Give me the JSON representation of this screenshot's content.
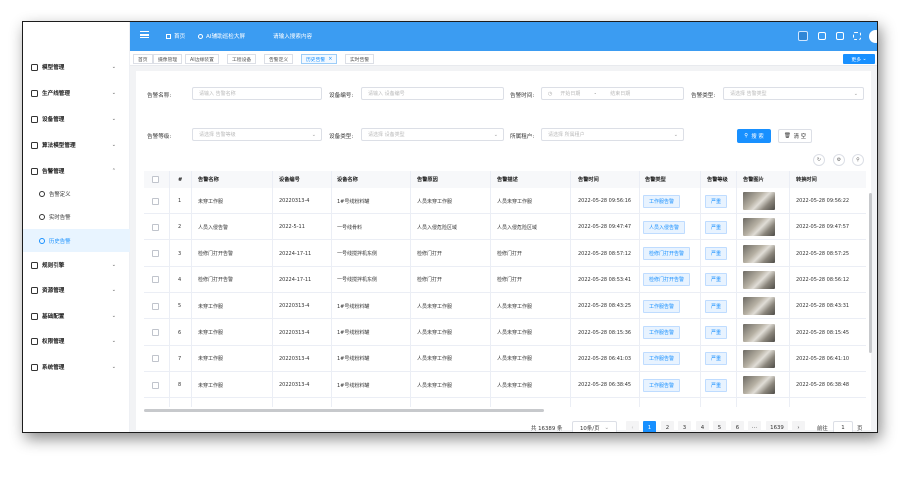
{
  "sidebar": {
    "items": [
      {
        "label": "模型管理",
        "icon": "grid-icon"
      },
      {
        "label": "生产线管理",
        "icon": "hierarchy-icon"
      },
      {
        "label": "设备管理",
        "icon": "device-icon"
      },
      {
        "label": "算法模型管理",
        "icon": "algorithm-icon"
      },
      {
        "label": "告警管理",
        "icon": "bell-icon",
        "expanded": true
      },
      {
        "label": "规则引擎",
        "icon": "rules-icon"
      },
      {
        "label": "资源管理",
        "icon": "resource-icon"
      },
      {
        "label": "基础配置",
        "icon": "cloud-icon"
      },
      {
        "label": "权限管理",
        "icon": "permission-icon"
      },
      {
        "label": "系统管理",
        "icon": "system-icon"
      }
    ],
    "sub_items": [
      {
        "label": "告警定义",
        "icon": "phone-icon"
      },
      {
        "label": "实时告警",
        "icon": "info-icon"
      },
      {
        "label": "历史告警",
        "icon": "bell-icon",
        "active": true
      }
    ]
  },
  "topbar": {
    "home": "首页",
    "screen": "AI辅助巡检大屏",
    "search_placeholder": "请输入搜索内容"
  },
  "tabs": [
    {
      "label": "首页"
    },
    {
      "label": "摄像管理"
    },
    {
      "label": "AI边缘装置"
    },
    {
      "label": "工程设备"
    },
    {
      "label": "告警定义"
    },
    {
      "label": "历史告警",
      "active": true
    },
    {
      "label": "实时告警"
    }
  ],
  "more_label": "更多",
  "filters": {
    "alarm_name_label": "告警名称:",
    "alarm_name_ph": "请输入 告警名称",
    "device_no_label": "设备编号:",
    "device_no_ph": "请输入 设备编号",
    "alarm_time_label": "告警时间:",
    "start_ph": "开始日期",
    "dash": "-",
    "end_ph": "结束日期",
    "alarm_type_label": "告警类型:",
    "alarm_type_ph": "请选择 告警类型",
    "alarm_level_label": "告警等级:",
    "alarm_level_ph": "请选择 告警等级",
    "device_type_label": "设备类型:",
    "device_type_ph": "请选择 设备类型",
    "tenant_label": "所属租户:",
    "tenant_ph": "请选择 所属租户",
    "search_btn": "搜 索",
    "reset_btn": "清 空"
  },
  "table": {
    "headers": [
      "#",
      "告警名称",
      "设备编号",
      "设备名称",
      "告警原因",
      "告警描述",
      "告警时间",
      "告警类型",
      "告警等级",
      "告警图片",
      "转换时间"
    ],
    "rows": [
      {
        "n": "1",
        "name": "未穿工作服",
        "dev_no": "20220313-4",
        "dev_name": "1#号线粉料罐",
        "reason": "人员未穿工作服",
        "desc": "人员未穿工作服",
        "time": "2022-05-28 09:56:16",
        "type": "工作服告警",
        "level": "严重",
        "conv": "2022-05-28 09:56:22"
      },
      {
        "n": "2",
        "name": "人员入侵告警",
        "dev_no": "2022-5-11",
        "dev_name": "一号线骨料",
        "reason": "人员入侵危险区域",
        "desc": "人员入侵危险区域",
        "time": "2022-05-28 09:47:47",
        "type": "人员入侵告警",
        "level": "严重",
        "conv": "2022-05-28 09:47:57"
      },
      {
        "n": "3",
        "name": "检修门打开告警",
        "dev_no": "20224-17-11",
        "dev_name": "一号线搅拌机东侧",
        "reason": "检修门打开",
        "desc": "检修门打开",
        "time": "2022-05-28 08:57:12",
        "type": "检修门打开告警",
        "level": "严重",
        "conv": "2022-05-28 08:57:25"
      },
      {
        "n": "4",
        "name": "检修门打开告警",
        "dev_no": "20224-17-11",
        "dev_name": "一号线搅拌机东侧",
        "reason": "检修门打开",
        "desc": "检修门打开",
        "time": "2022-05-28 08:53:41",
        "type": "检修门打开告警",
        "level": "严重",
        "conv": "2022-05-28 08:56:12"
      },
      {
        "n": "5",
        "name": "未穿工作服",
        "dev_no": "20220313-4",
        "dev_name": "1#号线粉料罐",
        "reason": "人员未穿工作服",
        "desc": "人员未穿工作服",
        "time": "2022-05-28 08:43:25",
        "type": "工作服告警",
        "level": "严重",
        "conv": "2022-05-28 08:43:31"
      },
      {
        "n": "6",
        "name": "未穿工作服",
        "dev_no": "20220313-4",
        "dev_name": "1#号线粉料罐",
        "reason": "人员未穿工作服",
        "desc": "人员未穿工作服",
        "time": "2022-05-28 08:15:36",
        "type": "工作服告警",
        "level": "严重",
        "conv": "2022-05-28 08:15:45"
      },
      {
        "n": "7",
        "name": "未穿工作服",
        "dev_no": "20220313-4",
        "dev_name": "1#号线粉料罐",
        "reason": "人员未穿工作服",
        "desc": "人员未穿工作服",
        "time": "2022-05-28 06:41:03",
        "type": "工作服告警",
        "level": "严重",
        "conv": "2022-05-28 06:41:10"
      },
      {
        "n": "8",
        "name": "未穿工作服",
        "dev_no": "20220313-4",
        "dev_name": "1#号线粉料罐",
        "reason": "人员未穿工作服",
        "desc": "人员未穿工作服",
        "time": "2022-05-28 06:38:45",
        "type": "工作服告警",
        "level": "严重",
        "conv": "2022-05-28 06:38:48"
      }
    ]
  },
  "pagination": {
    "total": "共 16389 条",
    "page_size": "10条/页",
    "pages": [
      "1",
      "2",
      "3",
      "4",
      "5",
      "6",
      "···",
      "1639"
    ],
    "prev": "‹",
    "next": "›",
    "goto_label": "前往",
    "goto_value": "1",
    "goto_unit": "页"
  },
  "colors": {
    "primary": "#1890ff",
    "topbar": "#3b9cf2"
  }
}
